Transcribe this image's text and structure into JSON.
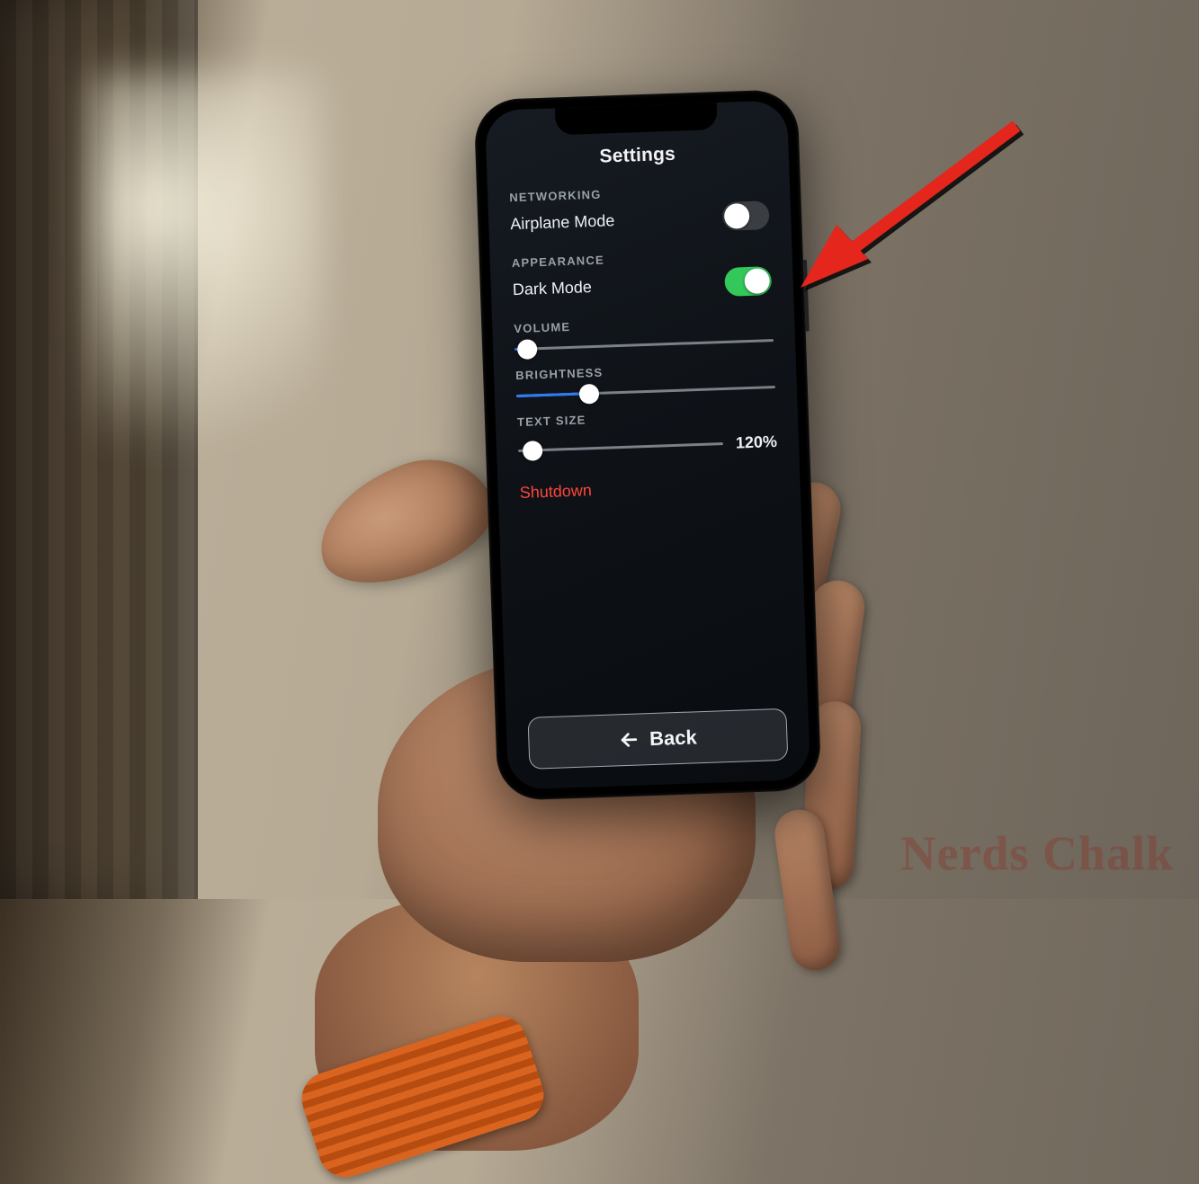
{
  "page_title": "Settings",
  "sections": {
    "networking": {
      "header": "NETWORKING",
      "airplane_label": "Airplane Mode",
      "airplane_on": false
    },
    "appearance": {
      "header": "APPEARANCE",
      "dark_label": "Dark Mode",
      "dark_on": true
    },
    "volume": {
      "header": "VOLUME",
      "percent": 5
    },
    "brightness": {
      "header": "BRIGHTNESS",
      "percent": 28
    },
    "text_size": {
      "header": "TEXT SIZE",
      "percent": 7,
      "value_label": "120%"
    }
  },
  "shutdown_label": "Shutdown",
  "back_label": "Back",
  "watermark": "Nerds Chalk",
  "annotation": "arrow-pointing-to-airplane-toggle",
  "colors": {
    "toggle_on": "#34c759",
    "toggle_off": "#3a3d42",
    "slider_fill": "#2f7bf6",
    "danger": "#ff453a",
    "arrow": "#e4261b"
  }
}
